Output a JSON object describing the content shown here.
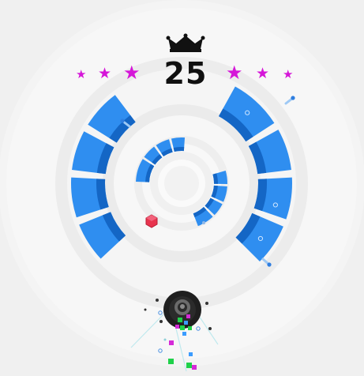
{
  "game": {
    "score": "25",
    "best_icon": "crown-icon",
    "stars_left": [
      "star-small",
      "star-medium",
      "star-large"
    ],
    "stars_right": [
      "star-large",
      "star-medium",
      "star-small"
    ],
    "colors": {
      "background": "#f0f0f0",
      "ring_light": "#f6f6f6",
      "ring_mid": "#e9e9e9",
      "block_face": "#2f8ef0",
      "block_side": "#1466c5",
      "star": "#d516d8",
      "enemy": "#e8344e",
      "player": "#1f1f1f",
      "player_ring": "#6b6b6b",
      "particle_green": "#1fd14a",
      "particle_magenta": "#d52ad8",
      "particle_blue": "#3b9cff"
    }
  }
}
